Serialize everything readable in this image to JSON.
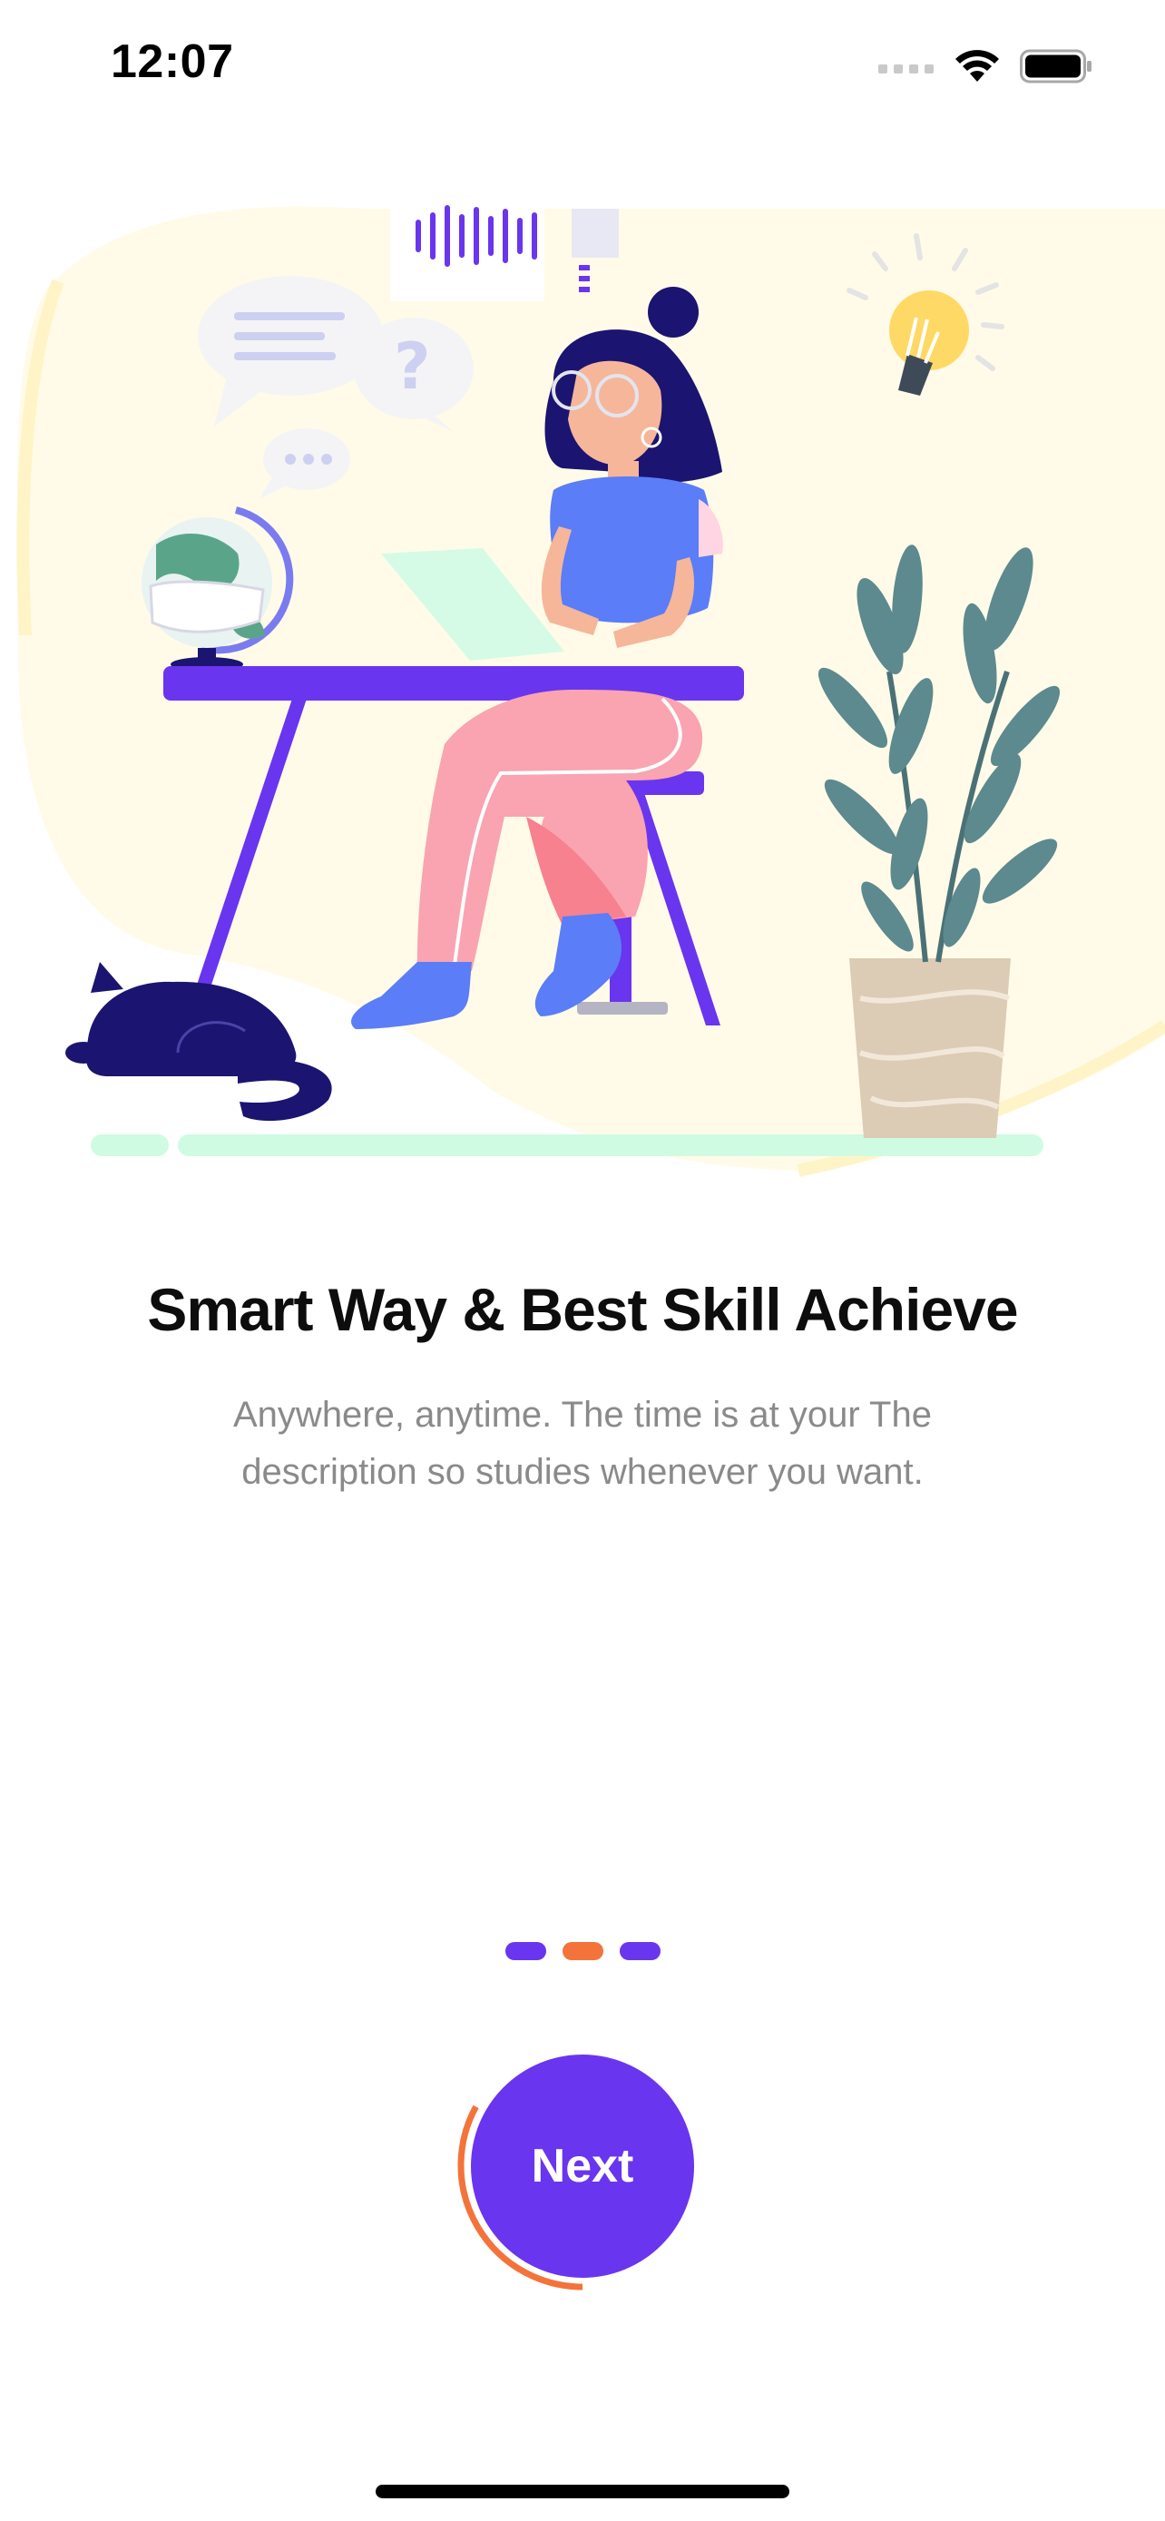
{
  "status_bar": {
    "time": "12:07",
    "icons": [
      "signal-icon",
      "wifi-icon",
      "battery-icon"
    ]
  },
  "onboarding": {
    "title": "Smart Way & Best Skill Achieve",
    "description": "Anywhere, anytime. The time is at your The description so studies whenever you want.",
    "page_indicator": {
      "count": 3,
      "active_index": 1
    },
    "next_label": "Next",
    "next_progress": 0.33
  },
  "colors": {
    "accent": "#6a35ee",
    "secondary": "#f4733a",
    "title": "#0d0d0d",
    "description": "#8a8a8a",
    "blob": "#fffbe8"
  }
}
